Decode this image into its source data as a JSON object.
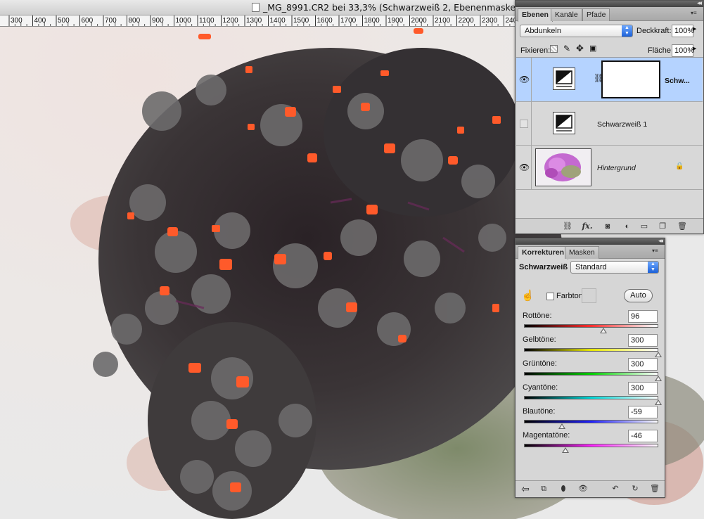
{
  "document": {
    "title": "_MG_8991.CR2 bei 33,3% (Schwarzweiß 2, Ebenenmaske",
    "ruler_ticks": [
      "300",
      "400",
      "500",
      "600",
      "700",
      "800",
      "900",
      "1000",
      "1100",
      "1200",
      "1300",
      "1400",
      "1500",
      "1600",
      "1700",
      "1800",
      "1900",
      "2000",
      "2100",
      "2200",
      "2300",
      "240"
    ]
  },
  "layers_panel": {
    "tabs": [
      {
        "label": "Ebenen",
        "active": true
      },
      {
        "label": "Kanäle",
        "active": false
      },
      {
        "label": "Pfade",
        "active": false
      }
    ],
    "blend_mode": "Abdunkeln",
    "opacity_label": "Deckkraft:",
    "opacity_value": "100%",
    "lock_label": "Fixieren:",
    "fill_label": "Fläche:",
    "fill_value": "100%",
    "layers": [
      {
        "name": "Schw...",
        "visible": true,
        "selected": true,
        "has_mask": true
      },
      {
        "name": "Schwarzweiß 1",
        "visible": false,
        "selected": false,
        "has_mask": false
      },
      {
        "name": "Hintergrund",
        "visible": true,
        "selected": false,
        "locked": true
      }
    ],
    "bottom_icons": [
      "link-icon",
      "fx-icon",
      "add-mask-icon",
      "new-adjustment-icon",
      "new-group-icon",
      "new-layer-icon",
      "trash-icon"
    ],
    "fx_label": "fx."
  },
  "adjustments_panel": {
    "tabs": [
      {
        "label": "Korrekturen",
        "active": true
      },
      {
        "label": "Masken",
        "active": false
      }
    ],
    "preset_label": "Schwarzweiß",
    "preset_value": "Standard",
    "tint_label": "Farbton",
    "tint_checked": false,
    "auto_label": "Auto",
    "sliders": [
      {
        "label": "Rottöne:",
        "value": "96",
        "min": -200,
        "max": 300,
        "gradient": [
          "#000000",
          "#ff2d2d",
          "#ffffff"
        ]
      },
      {
        "label": "Gelbtöne:",
        "value": "300",
        "min": -200,
        "max": 300,
        "gradient": [
          "#000000",
          "#e6e600",
          "#ffffff"
        ]
      },
      {
        "label": "Grüntöne:",
        "value": "300",
        "min": -200,
        "max": 300,
        "gradient": [
          "#000000",
          "#00d000",
          "#ffffff"
        ]
      },
      {
        "label": "Cyantöne:",
        "value": "300",
        "min": -200,
        "max": 300,
        "gradient": [
          "#000000",
          "#00d6d6",
          "#ffffff"
        ]
      },
      {
        "label": "Blautöne:",
        "value": "-59",
        "min": -200,
        "max": 300,
        "gradient": [
          "#000000",
          "#2020ff",
          "#ffffff"
        ]
      },
      {
        "label": "Magentatöne:",
        "value": "-46",
        "min": -200,
        "max": 300,
        "gradient": [
          "#000000",
          "#ff20ff",
          "#ffffff"
        ]
      }
    ],
    "bottom_icons": [
      "back-icon",
      "clip-layer-icon",
      "mask-visibility-icon",
      "eye-icon",
      "previous-state-icon",
      "reset-icon",
      "trash-icon"
    ]
  }
}
